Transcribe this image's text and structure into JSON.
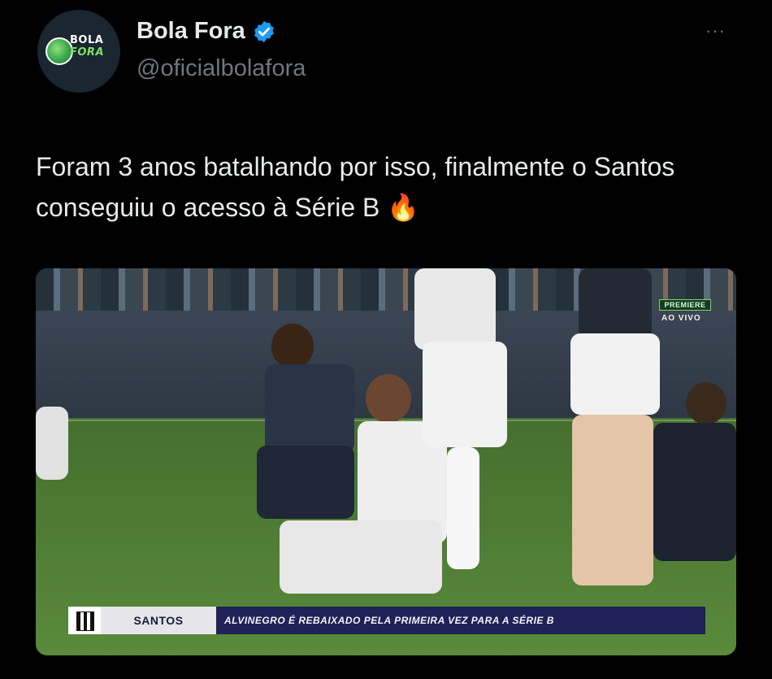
{
  "author": {
    "name": "Bola Fora",
    "handle": "@oficialbolafora",
    "avatar_text_line1": "BOLA",
    "avatar_text_line2": "FORA",
    "verified_icon": "verified-badge-icon",
    "verified_color": "#1d9bf0"
  },
  "menu": {
    "more_label": "···"
  },
  "tweet": {
    "text": "Foram 3 anos batalhando por isso, finalmente o Santos conseguiu o acesso à Série B 🔥"
  },
  "media": {
    "broadcaster": "PREMIERE",
    "live_label": "AO VIVO",
    "lower_third_team": "SANTOS",
    "lower_third_message": "ALVINEGRO É REBAIXADO PELA PRIMEIRA VEZ PARA A SÉRIE B",
    "lower_third_color": "#1f2157"
  },
  "colors": {
    "background": "#000000",
    "text_primary": "#e7e9ea",
    "text_secondary": "#71767b"
  }
}
